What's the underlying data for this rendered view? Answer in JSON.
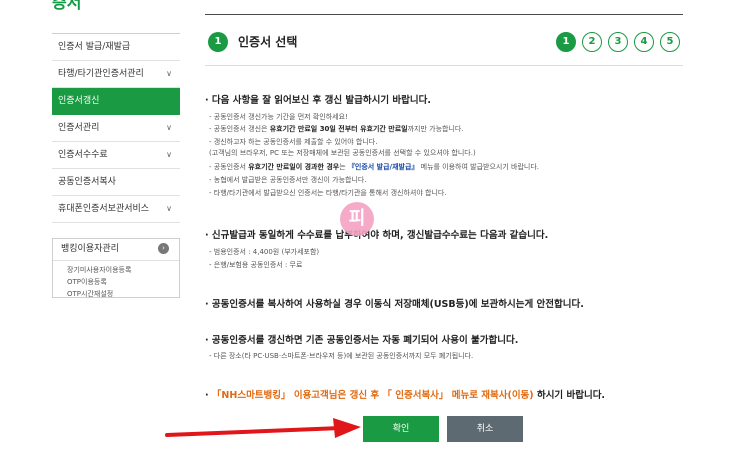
{
  "sidebar": {
    "title": "증서",
    "items": [
      {
        "label": "인증서 발급/재발급",
        "has_chevron": false,
        "active": false
      },
      {
        "label": "타행/타기관인증서관리",
        "has_chevron": true,
        "active": false
      },
      {
        "label": "인증서갱신",
        "has_chevron": false,
        "active": true
      },
      {
        "label": "인증서관리",
        "has_chevron": true,
        "active": false
      },
      {
        "label": "인증서수수료",
        "has_chevron": true,
        "active": false
      },
      {
        "label": "공동인증서복사",
        "has_chevron": false,
        "active": false
      },
      {
        "label": "휴대폰인증서보관서비스",
        "has_chevron": true,
        "active": false
      }
    ],
    "banking_box": {
      "title": "뱅킹이용자관리",
      "links": [
        "장기미사용자이용등록",
        "OTP이용등록",
        "OTP시간재설정"
      ]
    }
  },
  "main": {
    "step_number": "1",
    "step_title": "인증서 선택",
    "steps": [
      "1",
      "2",
      "3",
      "4",
      "5"
    ],
    "active_step": "1",
    "section1": {
      "heading": "· 다음 사항을 잘 읽어보신 후 갱신 발급하시기 바랍니다.",
      "line1": "- 공동인증서 갱신가능 기간을 먼저 확인하세요!",
      "line2_pre": "- 공동인증서 갱신은 ",
      "line2_bold": "유효기간 만료일 30일 전부터 유효기간 만료일",
      "line2_post": "까지만 가능합니다.",
      "line3": "- 갱신하고자 하는 공동인증서를 제출할 수 있어야 합니다.",
      "line4": "(고객님의 브라우저, PC 또는 저장매체에 보관된 공동인증서를 선택할 수 있으셔야 합니다.)",
      "line5_pre": "- 공동인증서 ",
      "line5_bold": "유효기간 만료일이 경과한 경우",
      "line5_mid": "는 ",
      "line5_blue": "『인증서 발급/재발급』",
      "line5_post": " 메뉴를 이용하여 발급받으시기 바랍니다.",
      "line6": "- 농협에서 발급받은 공동인증서만 갱신이 가능합니다.",
      "line7": "- 타행/타기관에서 발급받으신 인증서는 타행/타기관을 통해서 갱신하셔야 합니다."
    },
    "section2": {
      "heading": "· 신규발급과 동일하게 수수료를 납부하여야 하며, 갱신발급수수료는 다음과 같습니다.",
      "line1": "- 범용인증서 : 4,400원 (부가세포함)",
      "line2": "- 은행/보험용 공동인증서 : 무료"
    },
    "section3": {
      "heading": "· 공동인증서를 복사하여 사용하실 경우 이동식 저장매체(USB등)에 보관하시는게 안전합니다."
    },
    "section4": {
      "heading": "· 공동인증서를 갱신하면 기존 공동인증서는 자동 폐기되어 사용이 불가합니다.",
      "line1": "- 다른 장소(타 PC·USB·스마트폰·브라우저 등)에 보관된 공동인증서까지 모두 폐기됩니다."
    },
    "section5": {
      "dot": "· ",
      "orange1": "「NH스마트뱅킹」 이용고객님은 갱신 후 「 인증서복사」 메뉴로 재복사(이동)",
      "post": " 하시기 바랍니다."
    },
    "stamp_char": "피",
    "buttons": {
      "confirm": "확인",
      "cancel": "취소"
    }
  },
  "colors": {
    "brand_green": "#1a9b43",
    "annotation_red": "#e0161b",
    "orange": "#e06a12",
    "blue": "#1b4aa6"
  }
}
